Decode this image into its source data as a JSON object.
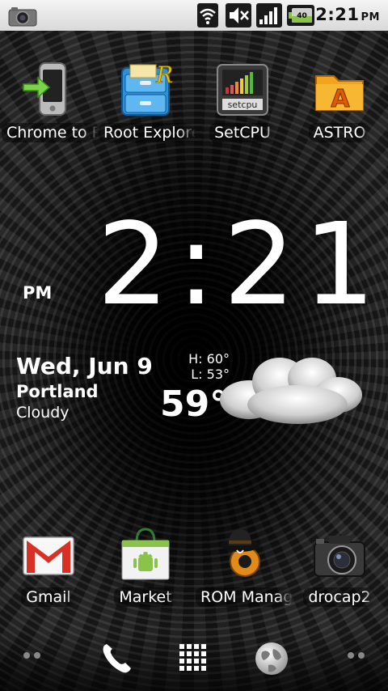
{
  "status_bar": {
    "icons": [
      "camera-notification-icon",
      "wifi-icon",
      "mute-icon",
      "signal-icon",
      "battery-icon"
    ],
    "battery_level": "40",
    "time": "2:21",
    "ampm": "PM"
  },
  "apps_top": [
    {
      "label": "Chrome to Phone",
      "icon": "phone-arrow-icon"
    },
    {
      "label": "Root Explorer",
      "icon": "file-cabinet-icon"
    },
    {
      "label": "SetCPU",
      "icon": "setcpu-icon"
    },
    {
      "label": "ASTRO",
      "icon": "folder-a-icon"
    }
  ],
  "clock": {
    "time": "2:21",
    "ampm": "PM"
  },
  "weather": {
    "date": "Wed, Jun 9",
    "city": "Portland",
    "condition": "Cloudy",
    "high": "H:  60°",
    "low": "L:  53°",
    "temp": "59°",
    "icon": "cloud-icon"
  },
  "apps_bottom": [
    {
      "label": "Gmail",
      "icon": "gmail-icon"
    },
    {
      "label": "Market",
      "icon": "market-bag-icon"
    },
    {
      "label": "ROM Manager",
      "icon": "rom-manager-icon"
    },
    {
      "label": "drocap2",
      "icon": "camera-icon"
    }
  ],
  "dock": {
    "items": [
      "left-dots-icon",
      "phone-icon",
      "app-drawer-icon",
      "browser-globe-icon",
      "right-dots-icon"
    ]
  },
  "colors": {
    "status_bar_bg": "#e6e6e6",
    "text": "#ffffff",
    "gmail_red": "#d93025",
    "market_green": "#8bc34a"
  }
}
